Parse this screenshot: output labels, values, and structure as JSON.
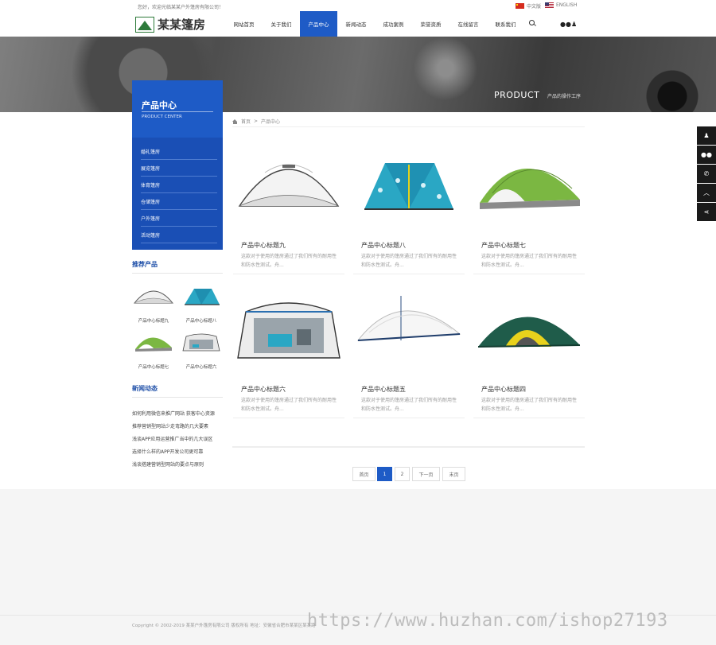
{
  "topbar": {
    "welcome": "您好，欢迎光临某某户外篷房有限公司！",
    "lang_cn": "中文版",
    "lang_en": "ENGLISH"
  },
  "logo": {
    "text": "某某篷房"
  },
  "nav": {
    "items": [
      "网站首页",
      "关于我们",
      "产品中心",
      "新闻动态",
      "成功案例",
      "荣誉资质",
      "在线留言",
      "联系我们"
    ],
    "active_index": 2
  },
  "banner": {
    "title": "PRODUCT",
    "subtitle": "产品的操作工序"
  },
  "sidebar": {
    "title": "产品中心",
    "title_en": "PRODUCT CENTER",
    "items": [
      "婚礼篷房",
      "展览篷房",
      "体育篷房",
      "仓储篷房",
      "户外篷房",
      "活动篷房"
    ]
  },
  "recommend": {
    "title": "推荐产品",
    "items": [
      "产品中心标题九",
      "产品中心标题八",
      "产品中心标题七",
      "产品中心标题六"
    ]
  },
  "news": {
    "title": "新闻动态",
    "items": [
      "如何利用微信来推广网站 获客中心资源",
      "推荐营销型网站少走弯路的几大要素",
      "浅谈APP应用运营推广当中的几大误区",
      "选择什么样的APP开发公司更可靠",
      "浅谈搭建营销型网站的要点与原则"
    ]
  },
  "breadcrumb": {
    "home": "首页",
    "separator": ">",
    "current": "产品中心"
  },
  "products": [
    {
      "title": "产品中心标题九",
      "desc": "这款对于使用的篷房通过了我们所有的耐用性和防水性测试。舟..."
    },
    {
      "title": "产品中心标题八",
      "desc": "这款对于使用的篷房通过了我们所有的耐用性和防水性测试。舟..."
    },
    {
      "title": "产品中心标题七",
      "desc": "这款对于使用的篷房通过了我们所有的耐用性和防水性测试。舟..."
    },
    {
      "title": "产品中心标题六",
      "desc": "这款对于使用的篷房通过了我们所有的耐用性和防水性测试。舟..."
    },
    {
      "title": "产品中心标题五",
      "desc": "这款对于使用的篷房通过了我们所有的耐用性和防水性测试。舟..."
    },
    {
      "title": "产品中心标题四",
      "desc": "这款对于使用的篷房通过了我们所有的耐用性和防水性测试。舟..."
    }
  ],
  "pagination": {
    "first": "首页",
    "pages": [
      "1",
      "2"
    ],
    "current": "1",
    "next": "下一页",
    "last": "末页"
  },
  "float_bar": {
    "icons": [
      "qq-icon",
      "wechat-icon",
      "phone-icon",
      "back-to-top-icon",
      "share-icon"
    ]
  },
  "footer": {
    "copyright": "Copyright © 2002-2019 某某户外篷房有限公司 版权所有   地址：安徽省合肥市某某区某某路"
  },
  "watermark": "https://www.huzhan.com/ishop27193",
  "colors": {
    "brand_blue": "#1e5bc6",
    "sidebar_menu": "#1a4fb5",
    "float_bar": "#1a1a1a"
  }
}
